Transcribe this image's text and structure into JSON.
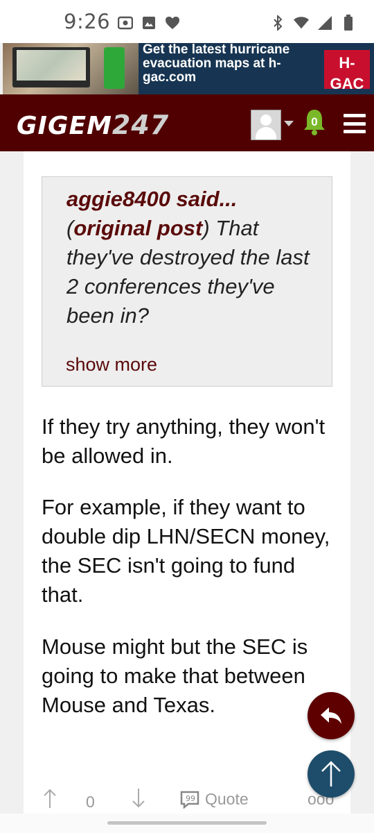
{
  "status_bar": {
    "time": "9:26",
    "left_icons": [
      "screen-cast-icon",
      "image-icon",
      "heart-icon"
    ],
    "right_icons": [
      "bluetooth-icon",
      "wifi-icon",
      "signal-icon",
      "battery-icon"
    ]
  },
  "ad": {
    "text": "Get the latest hurricane evacuation maps at h-gac.com",
    "logo_text": "H-GAC"
  },
  "header": {
    "logo_text": "GIGEM",
    "logo_number": "247",
    "notification_count": "0"
  },
  "quote": {
    "author_said": "aggie8400 said...",
    "original_post_label": "original post",
    "text": "That they've destroyed the last 2 conferences they've been in?",
    "show_more": "show more"
  },
  "post": {
    "paragraphs": [
      "If they try anything, they won't be allowed in.",
      "For example, if they want to double dip LHN/SECN money, the SEC isn't going to fund that.",
      "Mouse might but the SEC is going to make that between Mouse and Texas."
    ]
  },
  "actions": {
    "vote_count": "0",
    "quote_label": "Quote",
    "more_label": "ooo"
  },
  "colors": {
    "brand": "#500000",
    "reply_fab": "#5e0000",
    "top_fab": "#1e4d6b"
  }
}
